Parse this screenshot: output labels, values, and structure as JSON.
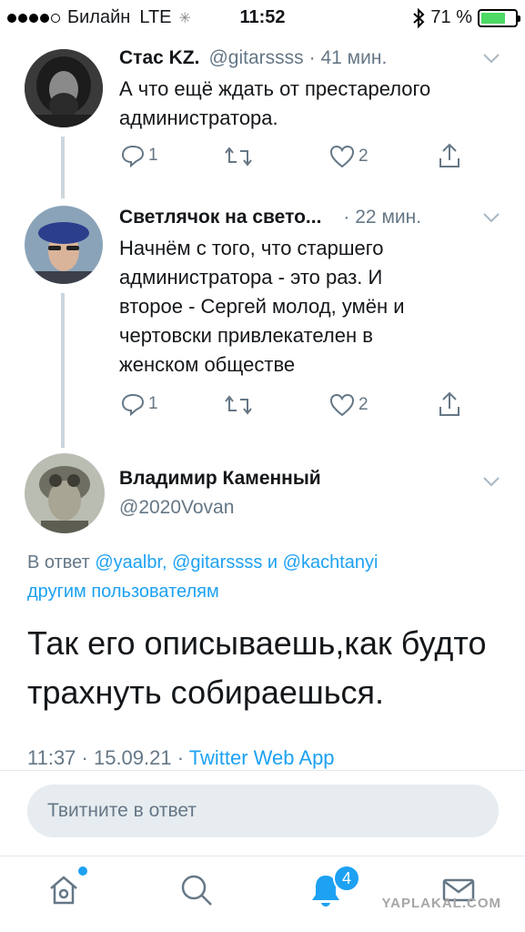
{
  "status_bar": {
    "carrier": "Билайн",
    "network": "LTE",
    "time": "11:52",
    "battery_percent": "71 %",
    "battery_level": 0.71
  },
  "tweets": [
    {
      "name": "Стас KZ.",
      "handle": "@gitarssss",
      "time": "· 41 мин.",
      "text_lines": [
        "А что ещё ждать от престарелого",
        "администратора."
      ],
      "reply_count": "1",
      "like_count": "2"
    },
    {
      "name": "Светлячок на свето...",
      "handle": "",
      "time": "· 22 мин.",
      "text_lines": [
        "Начнём с того, что старшего",
        "администратора - это раз. И",
        "второе - Сергей молод, умён и",
        "чертовски привлекателен в",
        "женском обществе"
      ],
      "reply_count": "1",
      "like_count": "2"
    }
  ],
  "main_tweet": {
    "name": "Владимир Каменный",
    "handle": "@2020Vovan",
    "reply_prefix": "В ответ",
    "reply_user1": "@yaalbr,",
    "reply_user2": "@gitarssss",
    "reply_and": "и",
    "reply_user3": "@kachtanyi",
    "reply_others": "другим пользователям",
    "text_lines": [
      "Так его описываешь,как будто",
      "трахнуть собираешься."
    ],
    "timestamp": "11:37 · 15.09.21 ·",
    "source": "Twitter Web App"
  },
  "reply_box": {
    "placeholder": "Твитните в ответ"
  },
  "tab_bar": {
    "notifications_badge": "4"
  },
  "watermark": "YAPLAKAL.COM",
  "colors": {
    "accent": "#1da1f2",
    "secondary_text": "#657786",
    "thread_line": "#ccd6dd",
    "battery": "#4cd964"
  }
}
